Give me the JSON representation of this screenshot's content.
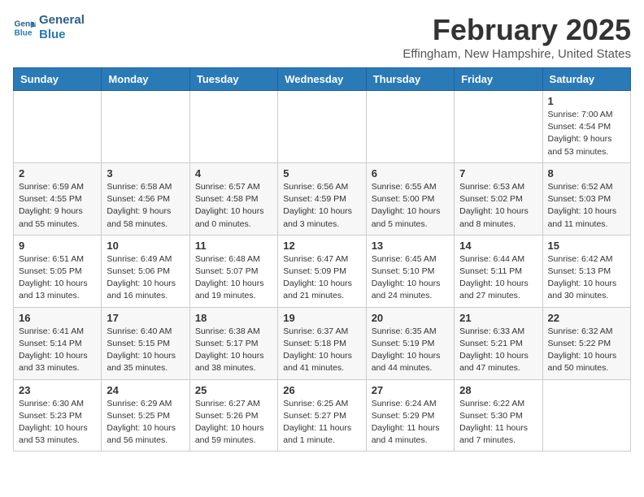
{
  "header": {
    "logo_line1": "General",
    "logo_line2": "Blue",
    "title": "February 2025",
    "subtitle": "Effingham, New Hampshire, United States"
  },
  "days_of_week": [
    "Sunday",
    "Monday",
    "Tuesday",
    "Wednesday",
    "Thursday",
    "Friday",
    "Saturday"
  ],
  "weeks": [
    [
      {
        "num": "",
        "info": ""
      },
      {
        "num": "",
        "info": ""
      },
      {
        "num": "",
        "info": ""
      },
      {
        "num": "",
        "info": ""
      },
      {
        "num": "",
        "info": ""
      },
      {
        "num": "",
        "info": ""
      },
      {
        "num": "1",
        "info": "Sunrise: 7:00 AM\nSunset: 4:54 PM\nDaylight: 9 hours\nand 53 minutes."
      }
    ],
    [
      {
        "num": "2",
        "info": "Sunrise: 6:59 AM\nSunset: 4:55 PM\nDaylight: 9 hours\nand 55 minutes."
      },
      {
        "num": "3",
        "info": "Sunrise: 6:58 AM\nSunset: 4:56 PM\nDaylight: 9 hours\nand 58 minutes."
      },
      {
        "num": "4",
        "info": "Sunrise: 6:57 AM\nSunset: 4:58 PM\nDaylight: 10 hours\nand 0 minutes."
      },
      {
        "num": "5",
        "info": "Sunrise: 6:56 AM\nSunset: 4:59 PM\nDaylight: 10 hours\nand 3 minutes."
      },
      {
        "num": "6",
        "info": "Sunrise: 6:55 AM\nSunset: 5:00 PM\nDaylight: 10 hours\nand 5 minutes."
      },
      {
        "num": "7",
        "info": "Sunrise: 6:53 AM\nSunset: 5:02 PM\nDaylight: 10 hours\nand 8 minutes."
      },
      {
        "num": "8",
        "info": "Sunrise: 6:52 AM\nSunset: 5:03 PM\nDaylight: 10 hours\nand 11 minutes."
      }
    ],
    [
      {
        "num": "9",
        "info": "Sunrise: 6:51 AM\nSunset: 5:05 PM\nDaylight: 10 hours\nand 13 minutes."
      },
      {
        "num": "10",
        "info": "Sunrise: 6:49 AM\nSunset: 5:06 PM\nDaylight: 10 hours\nand 16 minutes."
      },
      {
        "num": "11",
        "info": "Sunrise: 6:48 AM\nSunset: 5:07 PM\nDaylight: 10 hours\nand 19 minutes."
      },
      {
        "num": "12",
        "info": "Sunrise: 6:47 AM\nSunset: 5:09 PM\nDaylight: 10 hours\nand 21 minutes."
      },
      {
        "num": "13",
        "info": "Sunrise: 6:45 AM\nSunset: 5:10 PM\nDaylight: 10 hours\nand 24 minutes."
      },
      {
        "num": "14",
        "info": "Sunrise: 6:44 AM\nSunset: 5:11 PM\nDaylight: 10 hours\nand 27 minutes."
      },
      {
        "num": "15",
        "info": "Sunrise: 6:42 AM\nSunset: 5:13 PM\nDaylight: 10 hours\nand 30 minutes."
      }
    ],
    [
      {
        "num": "16",
        "info": "Sunrise: 6:41 AM\nSunset: 5:14 PM\nDaylight: 10 hours\nand 33 minutes."
      },
      {
        "num": "17",
        "info": "Sunrise: 6:40 AM\nSunset: 5:15 PM\nDaylight: 10 hours\nand 35 minutes."
      },
      {
        "num": "18",
        "info": "Sunrise: 6:38 AM\nSunset: 5:17 PM\nDaylight: 10 hours\nand 38 minutes."
      },
      {
        "num": "19",
        "info": "Sunrise: 6:37 AM\nSunset: 5:18 PM\nDaylight: 10 hours\nand 41 minutes."
      },
      {
        "num": "20",
        "info": "Sunrise: 6:35 AM\nSunset: 5:19 PM\nDaylight: 10 hours\nand 44 minutes."
      },
      {
        "num": "21",
        "info": "Sunrise: 6:33 AM\nSunset: 5:21 PM\nDaylight: 10 hours\nand 47 minutes."
      },
      {
        "num": "22",
        "info": "Sunrise: 6:32 AM\nSunset: 5:22 PM\nDaylight: 10 hours\nand 50 minutes."
      }
    ],
    [
      {
        "num": "23",
        "info": "Sunrise: 6:30 AM\nSunset: 5:23 PM\nDaylight: 10 hours\nand 53 minutes."
      },
      {
        "num": "24",
        "info": "Sunrise: 6:29 AM\nSunset: 5:25 PM\nDaylight: 10 hours\nand 56 minutes."
      },
      {
        "num": "25",
        "info": "Sunrise: 6:27 AM\nSunset: 5:26 PM\nDaylight: 10 hours\nand 59 minutes."
      },
      {
        "num": "26",
        "info": "Sunrise: 6:25 AM\nSunset: 5:27 PM\nDaylight: 11 hours\nand 1 minute."
      },
      {
        "num": "27",
        "info": "Sunrise: 6:24 AM\nSunset: 5:29 PM\nDaylight: 11 hours\nand 4 minutes."
      },
      {
        "num": "28",
        "info": "Sunrise: 6:22 AM\nSunset: 5:30 PM\nDaylight: 11 hours\nand 7 minutes."
      },
      {
        "num": "",
        "info": ""
      }
    ]
  ]
}
